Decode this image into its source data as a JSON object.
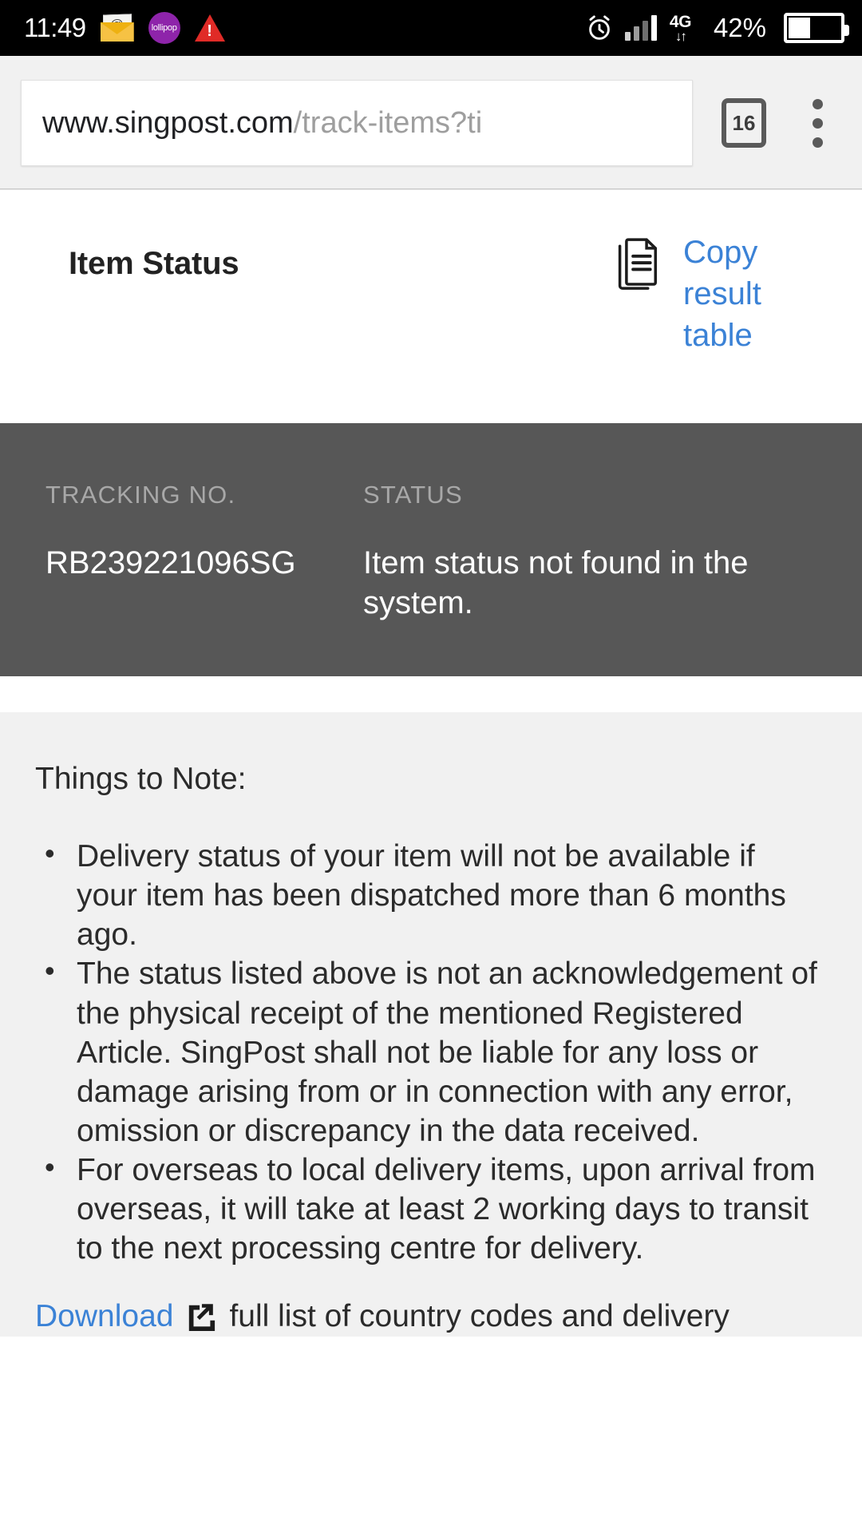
{
  "statusbar": {
    "clock": "11:49",
    "icons": [
      "mail-at-icon",
      "lollipop-icon",
      "warning-triangle-icon"
    ],
    "alarm_icon": "alarm-clock-icon",
    "signal_icon": "cellular-signal-icon",
    "network_type": "4G",
    "network_arrows": "↓↑",
    "battery_percent": "42%",
    "battery_fill_ratio": 0.42
  },
  "browser": {
    "url_host": "www.singpost.com",
    "url_path": "/track-items?ti",
    "url_full": "www.singpost.com/track-items?ti",
    "tab_count": "16",
    "menu_icon": "kebab-menu-icon"
  },
  "header": {
    "title": "Item Status",
    "copy_icon": "copy-document-icon",
    "copy_link": "Copy result table"
  },
  "result": {
    "tracking_label": "TRACKING NO.",
    "tracking_value": "RB239221096SG",
    "status_label": "STATUS",
    "status_value": "Item status not found in the system.",
    "panel_color": "#575757"
  },
  "notes": {
    "title": "Things to Note:",
    "items": [
      "Delivery status of your item will not be available if your item has been dispatched more than 6 months ago.",
      "The status listed above is not an acknowledgement of the physical receipt of the mentioned Registered Article. SingPost shall not be liable for any loss or damage arising from or in connection with any error, omission or discrepancy in the data received.",
      "For overseas to local delivery items, upon arrival from overseas, it will take at least 2 working days to transit to the next processing centre for delivery."
    ],
    "download_link": "Download",
    "external_icon": "external-link-icon",
    "download_tail": "full list of country codes and delivery"
  },
  "colors": {
    "link_blue": "#3b82d6",
    "panel_gray": "#575757",
    "notes_bg": "#f1f1f1",
    "toolbar_bg": "#f1f1f1"
  }
}
